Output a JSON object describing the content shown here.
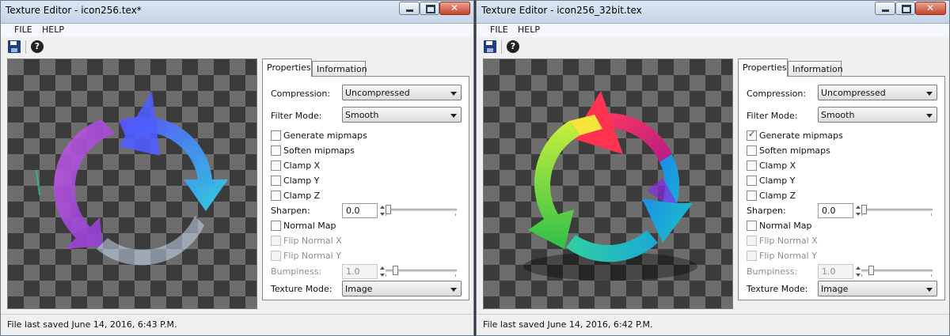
{
  "windows": [
    {
      "title": "Texture Editor - icon256.tex*",
      "menu": [
        "FILE",
        "HELP"
      ],
      "tabs": [
        "Properties",
        "Information"
      ],
      "labels": {
        "compression": "Compression:",
        "filter": "Filter Mode:",
        "sharpen": "Sharpen:",
        "bumpiness": "Bumpiness:",
        "texture_mode": "Texture Mode:"
      },
      "compression": "Uncompressed",
      "filter_mode": "Smooth",
      "texture_mode": "Image",
      "checks": [
        {
          "label": "Generate mipmaps",
          "checked": false,
          "enabled": true
        },
        {
          "label": "Soften mipmaps",
          "checked": false,
          "enabled": true
        },
        {
          "label": "Clamp X",
          "checked": false,
          "enabled": true
        },
        {
          "label": "Clamp Y",
          "checked": false,
          "enabled": true
        },
        {
          "label": "Clamp Z",
          "checked": false,
          "enabled": true
        }
      ],
      "checks2": [
        {
          "label": "Normal Map",
          "checked": false,
          "enabled": true
        },
        {
          "label": "Flip Normal X",
          "checked": false,
          "enabled": false
        },
        {
          "label": "Flip Normal Y",
          "checked": false,
          "enabled": false
        }
      ],
      "sharpen": "0.0",
      "bumpiness": "1.0",
      "status": "File last saved June 14, 2016, 6:43 P.M."
    },
    {
      "title": "Texture Editor - icon256_32bit.tex",
      "menu": [
        "FILE",
        "HELP"
      ],
      "tabs": [
        "Properties",
        "Information"
      ],
      "labels": {
        "compression": "Compression:",
        "filter": "Filter Mode:",
        "sharpen": "Sharpen:",
        "bumpiness": "Bumpiness:",
        "texture_mode": "Texture Mode:"
      },
      "compression": "Uncompressed",
      "filter_mode": "Smooth",
      "texture_mode": "Image",
      "checks": [
        {
          "label": "Generate mipmaps",
          "checked": true,
          "enabled": true
        },
        {
          "label": "Soften mipmaps",
          "checked": false,
          "enabled": true
        },
        {
          "label": "Clamp X",
          "checked": false,
          "enabled": true
        },
        {
          "label": "Clamp Y",
          "checked": false,
          "enabled": true
        },
        {
          "label": "Clamp Z",
          "checked": false,
          "enabled": true
        }
      ],
      "checks2": [
        {
          "label": "Normal Map",
          "checked": false,
          "enabled": true
        },
        {
          "label": "Flip Normal X",
          "checked": false,
          "enabled": false
        },
        {
          "label": "Flip Normal Y",
          "checked": false,
          "enabled": false
        }
      ],
      "sharpen": "0.0",
      "bumpiness": "1.0",
      "status": "File last saved June 14, 2016, 6:42 P.M."
    }
  ],
  "icons": {
    "save": "save-icon",
    "help": "help-icon",
    "minimize": "minimize-icon",
    "maximize": "maximize-icon",
    "close": "close-icon"
  }
}
